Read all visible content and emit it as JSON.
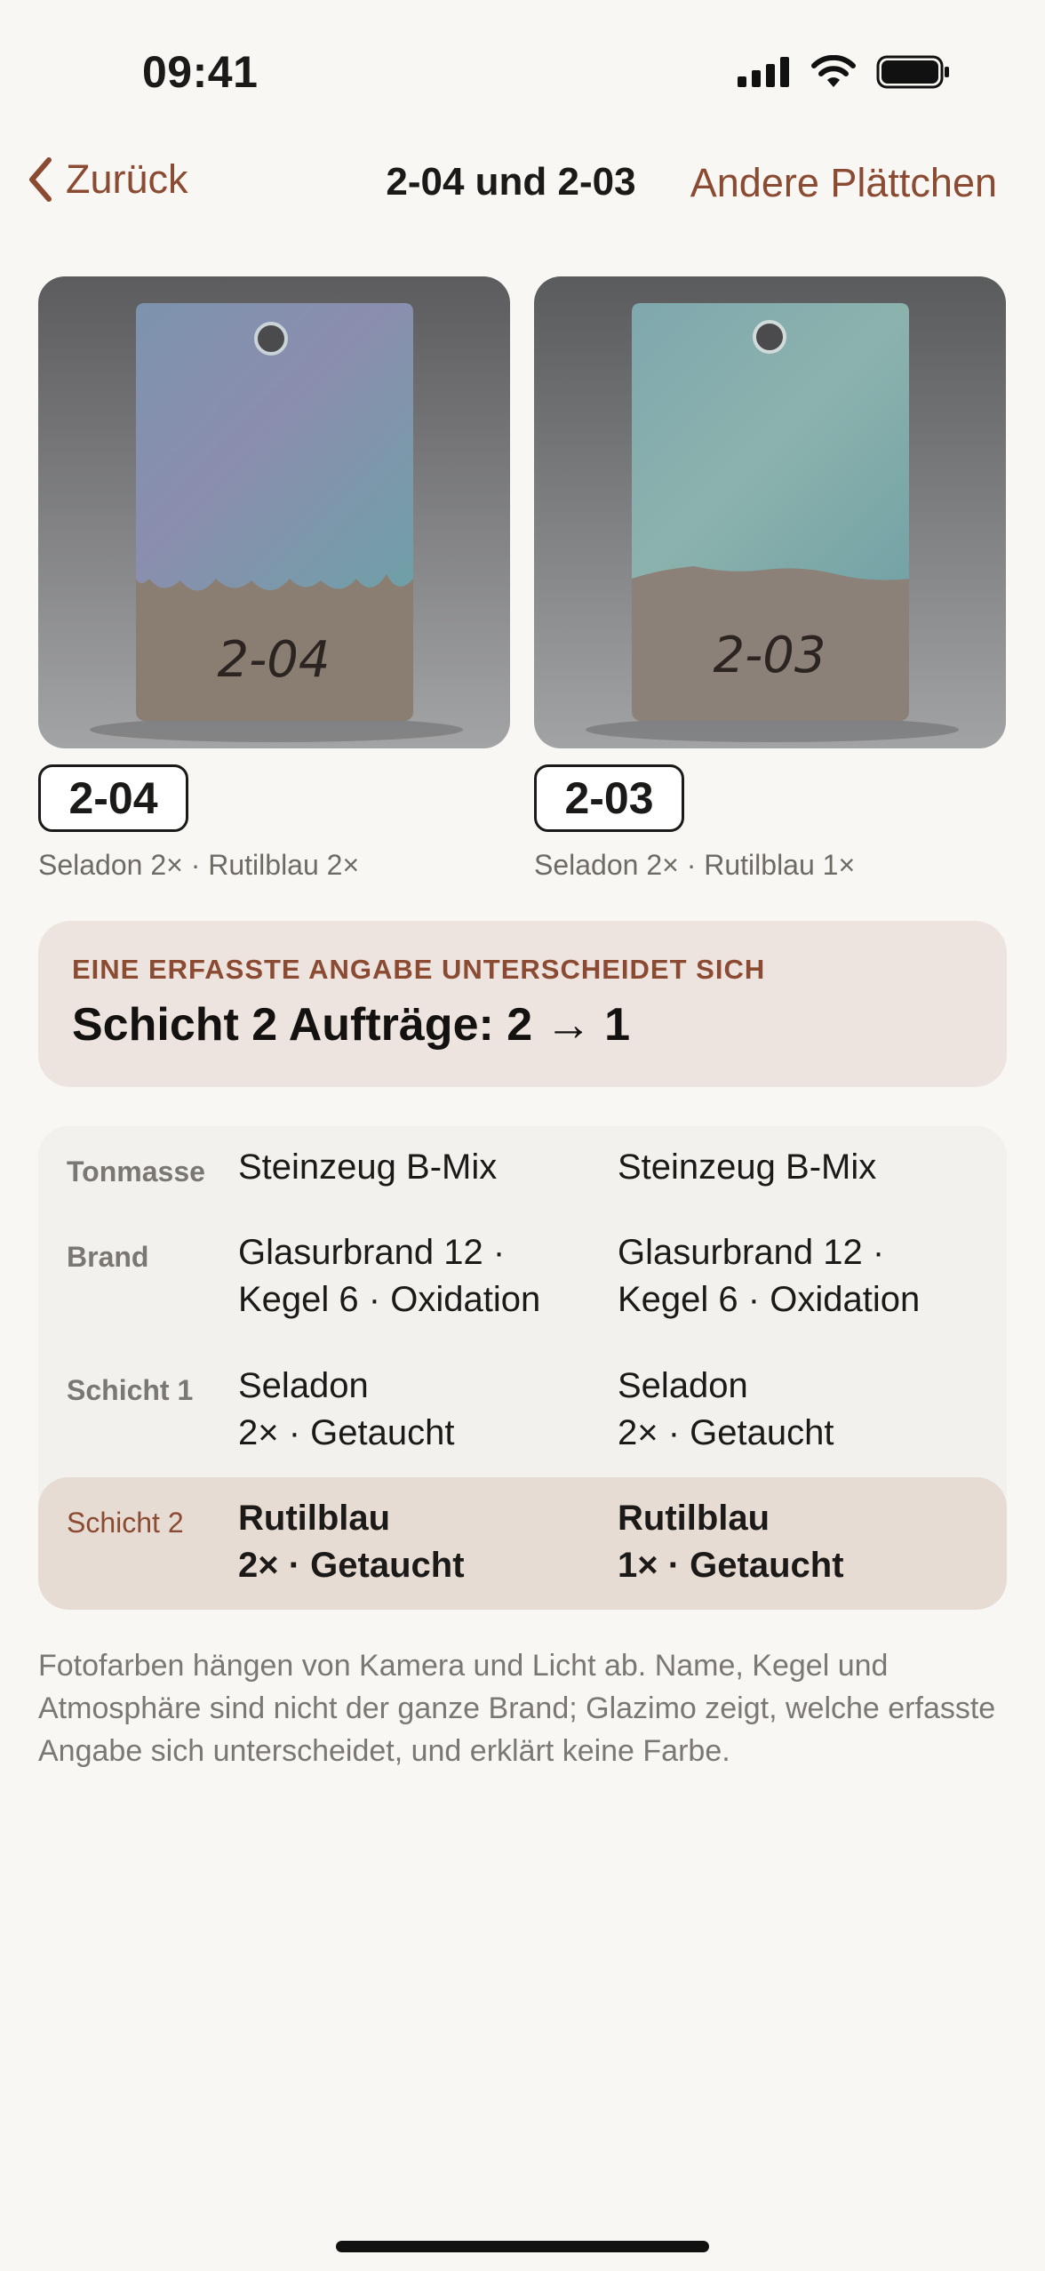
{
  "status": {
    "time": "09:41",
    "icons": [
      "cellular-signal-icon",
      "wifi-icon",
      "battery-icon"
    ]
  },
  "nav": {
    "back_label": "Zurück",
    "title": "2-04 und 2-03",
    "right_label": "Andere Plättchen"
  },
  "tiles": [
    {
      "id": "2-04",
      "marking": "2-04",
      "glazes": "Seladon 2× · Rutilblau 2×"
    },
    {
      "id": "2-03",
      "marking": "2-03",
      "glazes": "Seladon 2× · Rutilblau 1×"
    }
  ],
  "difference": {
    "kicker": "EINE ERFASSTE ANGABE UNTERSCHEIDET SICH",
    "headline": "Schicht 2 Aufträge: 2 → 1"
  },
  "comparison": {
    "rows": [
      {
        "label": "Tonmasse",
        "left": [
          "Steinzeug B-Mix"
        ],
        "right": [
          "Steinzeug B-Mix"
        ],
        "highlight": false
      },
      {
        "label": "Brand",
        "left": [
          "Glasurbrand 12 ·",
          "Kegel 6 · Oxidation"
        ],
        "right": [
          "Glasurbrand 12 ·",
          "Kegel 6 · Oxidation"
        ],
        "highlight": false
      },
      {
        "label": "Schicht 1",
        "left": [
          "Seladon",
          "2× · Getaucht"
        ],
        "right": [
          "Seladon",
          "2× · Getaucht"
        ],
        "highlight": false
      },
      {
        "label": "Schicht 2",
        "left": [
          "Rutilblau",
          "2× · Getaucht"
        ],
        "right": [
          "Rutilblau",
          "1× · Getaucht"
        ],
        "highlight": true
      }
    ]
  },
  "footnote": "Fotofarben hängen von Kamera und Licht ab. Name, Kegel und Atmosphäre sind nicht der ganze Brand; Glazimo zeigt, welche erfasste Angabe sich unterscheidet, und erklärt keine Farbe.",
  "colors": {
    "accent": "#8b4a32",
    "background": "#f9f7f3",
    "difference_card": "#ede4df",
    "highlight_row": "#e7dcd3"
  }
}
